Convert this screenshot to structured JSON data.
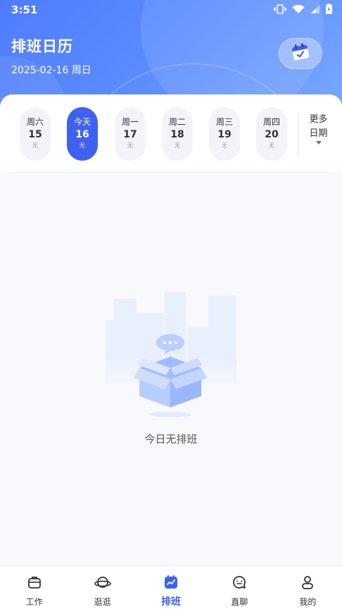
{
  "status_bar": {
    "time": "3:51"
  },
  "header": {
    "title": "排班日历",
    "date": "2025-02-16 周日",
    "calendar_icon": "calendar-check-icon"
  },
  "week": [
    {
      "name": "周六",
      "day": "15",
      "status": "无",
      "active": false
    },
    {
      "name": "今天",
      "day": "16",
      "status": "无",
      "active": true
    },
    {
      "name": "周一",
      "day": "17",
      "status": "无",
      "active": false
    },
    {
      "name": "周二",
      "day": "18",
      "status": "无",
      "active": false
    },
    {
      "name": "周三",
      "day": "19",
      "status": "无",
      "active": false
    },
    {
      "name": "周四",
      "day": "20",
      "status": "无",
      "active": false
    }
  ],
  "more_dates": {
    "line1": "更多",
    "line2": "日期"
  },
  "empty_state": {
    "text": "今日无排班"
  },
  "tabbar": {
    "items": [
      {
        "label": "工作",
        "icon": "briefcase-icon",
        "active": false
      },
      {
        "label": "逛逛",
        "icon": "planet-icon",
        "active": false
      },
      {
        "label": "排班",
        "icon": "schedule-icon",
        "active": true
      },
      {
        "label": "直聊",
        "icon": "chat-icon",
        "active": false
      },
      {
        "label": "我的",
        "icon": "user-icon",
        "active": false
      }
    ]
  },
  "colors": {
    "primary": "#3e62f0",
    "header_start": "#4f7cff",
    "header_end": "#7aa8ff"
  }
}
